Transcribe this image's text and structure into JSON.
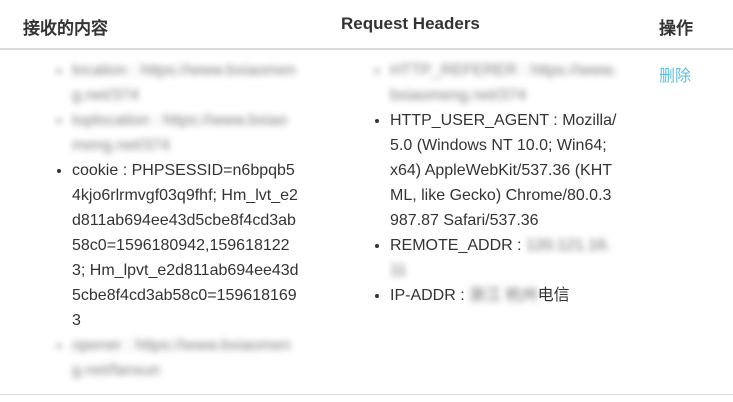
{
  "table": {
    "headers": {
      "received": "接收的内容",
      "request_headers": "Request Headers",
      "actions": "操作"
    }
  },
  "received_items": {
    "location": "location : https://www.bxiaomeng.net/374",
    "toplocation": "toplocation : https://www.bxiaomeng.net/374",
    "cookie": "cookie : PHPSESSID=n6bpqb54kjo6rlrmvgf03q9fhf; Hm_lvt_e2d811ab694ee43d5cbe8f4cd3ab58c0=1596180942,1596181223; Hm_lpvt_e2d811ab694ee43d5cbe8f4cd3ab58c0=1596181693",
    "opener": "opener : https://www.bxiaomeng.net/fanxun"
  },
  "request_headers": {
    "referer": "HTTP_REFERER : https://www.bxiaomeng.net/374",
    "user_agent": "HTTP_USER_AGENT : Mozilla/5.0 (Windows NT 10.0; Win64; x64) AppleWebKit/537.36 (KHTML, like Gecko) Chrome/80.0.3987.87 Safari/537.36",
    "remote_addr_label": "REMOTE_ADDR : ",
    "remote_addr_value": "120.121.16.11",
    "ip_addr_label": "IP-ADDR : ",
    "ip_addr_region": "浙江 杭州",
    "ip_addr_isp": "电信"
  },
  "actions": {
    "delete_label": "删除"
  }
}
